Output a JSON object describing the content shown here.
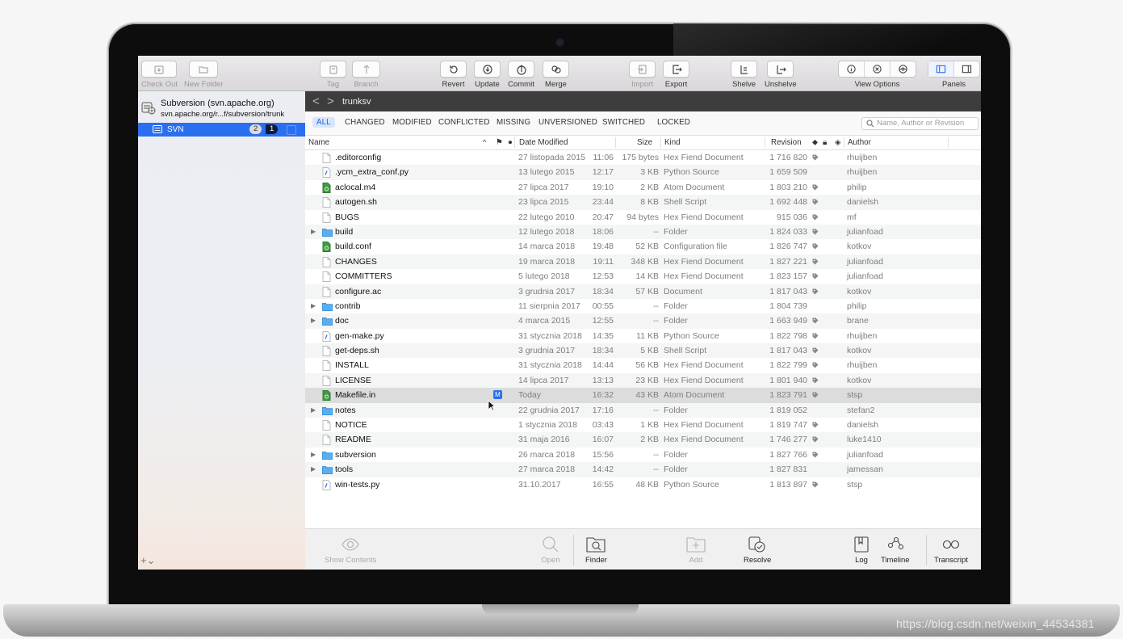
{
  "toolbar": {
    "check_out": "Check Out",
    "new_folder": "New Folder",
    "tag": "Tag",
    "branch": "Branch",
    "revert": "Revert",
    "update": "Update",
    "commit": "Commit",
    "merge": "Merge",
    "import": "Import",
    "export": "Export",
    "shelve": "Shelve",
    "unshelve": "Unshelve",
    "view_options": "View Options",
    "panels": "Panels"
  },
  "sidebar": {
    "repo_title": "Subversion (svn.apache.org)",
    "repo_url": "svn.apache.org/r...f/subversion/trunk",
    "working_copy": "SVN",
    "badge_modified": "2",
    "badge_other": "1",
    "add_label": "+⌄"
  },
  "path": {
    "back": "<",
    "forward": ">",
    "title": "trunksv"
  },
  "filters": [
    "ALL",
    "CHANGED",
    "MODIFIED",
    "CONFLICTED",
    "MISSING",
    "UNVERSIONED",
    "SWITCHED",
    "LOCKED"
  ],
  "search": {
    "placeholder": "Name, Author or Revision"
  },
  "columns": {
    "name": "Name",
    "date": "Date Modified",
    "size": "Size",
    "kind": "Kind",
    "revision": "Revision",
    "author": "Author"
  },
  "files": [
    {
      "name": ".editorconfig",
      "type": "doc",
      "date": "27 listopada 2015",
      "time": "11:06",
      "size": "175 bytes",
      "kind": "Hex Fiend Document",
      "rev": "1 716 820",
      "tag": true,
      "author": "rhuijben"
    },
    {
      "name": ".ycm_extra_conf.py",
      "type": "py",
      "date": "13 lutego 2015",
      "time": "12:17",
      "size": "3 KB",
      "kind": "Python Source",
      "rev": "1 659 509",
      "tag": false,
      "author": "rhuijben"
    },
    {
      "name": "aclocal.m4",
      "type": "green",
      "date": "27 lipca 2017",
      "time": "19:10",
      "size": "2 KB",
      "kind": "Atom Document",
      "rev": "1 803 210",
      "tag": true,
      "author": "philip"
    },
    {
      "name": "autogen.sh",
      "type": "doc",
      "date": "23 lipca 2015",
      "time": "23:44",
      "size": "8 KB",
      "kind": "Shell Script",
      "rev": "1 692 448",
      "tag": true,
      "author": "danielsh"
    },
    {
      "name": "BUGS",
      "type": "doc",
      "date": "22 lutego 2010",
      "time": "20:47",
      "size": "94 bytes",
      "kind": "Hex Fiend Document",
      "rev": "915 036",
      "tag": true,
      "author": "mf"
    },
    {
      "name": "build",
      "type": "folder",
      "date": "12 lutego 2018",
      "time": "18:06",
      "size": "--",
      "kind": "Folder",
      "rev": "1 824 033",
      "tag": true,
      "author": "julianfoad"
    },
    {
      "name": "build.conf",
      "type": "green",
      "date": "14 marca 2018",
      "time": "19:48",
      "size": "52 KB",
      "kind": "Configuration file",
      "rev": "1 826 747",
      "tag": true,
      "author": "kotkov"
    },
    {
      "name": "CHANGES",
      "type": "doc",
      "date": "19 marca 2018",
      "time": "19:11",
      "size": "348 KB",
      "kind": "Hex Fiend Document",
      "rev": "1 827 221",
      "tag": true,
      "author": "julianfoad"
    },
    {
      "name": "COMMITTERS",
      "type": "doc",
      "date": "5 lutego 2018",
      "time": "12:53",
      "size": "14 KB",
      "kind": "Hex Fiend Document",
      "rev": "1 823 157",
      "tag": true,
      "author": "julianfoad"
    },
    {
      "name": "configure.ac",
      "type": "doc",
      "date": "3 grudnia 2017",
      "time": "18:34",
      "size": "57 KB",
      "kind": "Document",
      "rev": "1 817 043",
      "tag": true,
      "author": "kotkov"
    },
    {
      "name": "contrib",
      "type": "folder",
      "date": "11 sierpnia 2017",
      "time": "00:55",
      "size": "--",
      "kind": "Folder",
      "rev": "1 804 739",
      "tag": false,
      "author": "philip"
    },
    {
      "name": "doc",
      "type": "folder",
      "date": "4 marca 2015",
      "time": "12:55",
      "size": "--",
      "kind": "Folder",
      "rev": "1 663 949",
      "tag": true,
      "author": "brane"
    },
    {
      "name": "gen-make.py",
      "type": "py",
      "date": "31 stycznia 2018",
      "time": "14:35",
      "size": "11 KB",
      "kind": "Python Source",
      "rev": "1 822 798",
      "tag": true,
      "author": "rhuijben"
    },
    {
      "name": "get-deps.sh",
      "type": "doc",
      "date": "3 grudnia 2017",
      "time": "18:34",
      "size": "5 KB",
      "kind": "Shell Script",
      "rev": "1 817 043",
      "tag": true,
      "author": "kotkov"
    },
    {
      "name": "INSTALL",
      "type": "doc",
      "date": "31 stycznia 2018",
      "time": "14:44",
      "size": "56 KB",
      "kind": "Hex Fiend Document",
      "rev": "1 822 799",
      "tag": true,
      "author": "rhuijben"
    },
    {
      "name": "LICENSE",
      "type": "doc",
      "date": "14 lipca 2017",
      "time": "13:13",
      "size": "23 KB",
      "kind": "Hex Fiend Document",
      "rev": "1 801 940",
      "tag": true,
      "author": "kotkov"
    },
    {
      "name": "Makefile.in",
      "type": "green",
      "date": "Today",
      "time": "16:32",
      "size": "43 KB",
      "kind": "Atom Document",
      "rev": "1 823 791",
      "tag": true,
      "author": "stsp",
      "status": "M",
      "selected": true
    },
    {
      "name": "notes",
      "type": "folder",
      "date": "22 grudnia 2017",
      "time": "17:16",
      "size": "--",
      "kind": "Folder",
      "rev": "1 819 052",
      "tag": false,
      "author": "stefan2"
    },
    {
      "name": "NOTICE",
      "type": "doc",
      "date": "1 stycznia 2018",
      "time": "03:43",
      "size": "1 KB",
      "kind": "Hex Fiend Document",
      "rev": "1 819 747",
      "tag": true,
      "author": "danielsh"
    },
    {
      "name": "README",
      "type": "doc",
      "date": "31 maja 2016",
      "time": "16:07",
      "size": "2 KB",
      "kind": "Hex Fiend Document",
      "rev": "1 746 277",
      "tag": true,
      "author": "luke1410"
    },
    {
      "name": "subversion",
      "type": "folder",
      "date": "26 marca 2018",
      "time": "15:56",
      "size": "--",
      "kind": "Folder",
      "rev": "1 827 766",
      "tag": true,
      "author": "julianfoad"
    },
    {
      "name": "tools",
      "type": "folder",
      "date": "27 marca 2018",
      "time": "14:42",
      "size": "--",
      "kind": "Folder",
      "rev": "1 827 831",
      "tag": false,
      "author": "jamessan"
    },
    {
      "name": "win-tests.py",
      "type": "py",
      "date": "31.10.2017",
      "time": "16:55",
      "size": "48 KB",
      "kind": "Python Source",
      "rev": "1 813 897",
      "tag": true,
      "author": "stsp"
    }
  ],
  "bottom": {
    "show_contents": "Show Contents",
    "open": "Open",
    "finder": "Finder",
    "add": "Add",
    "resolve": "Resolve",
    "log": "Log",
    "timeline": "Timeline",
    "transcript": "Transcript"
  },
  "watermark": "https://blog.csdn.net/weixin_44534381",
  "colors": {
    "accent": "#2a6ff0",
    "pathbar": "#3d3d3d",
    "folder": "#5aaef0",
    "green_file": "#3f9b3f"
  }
}
